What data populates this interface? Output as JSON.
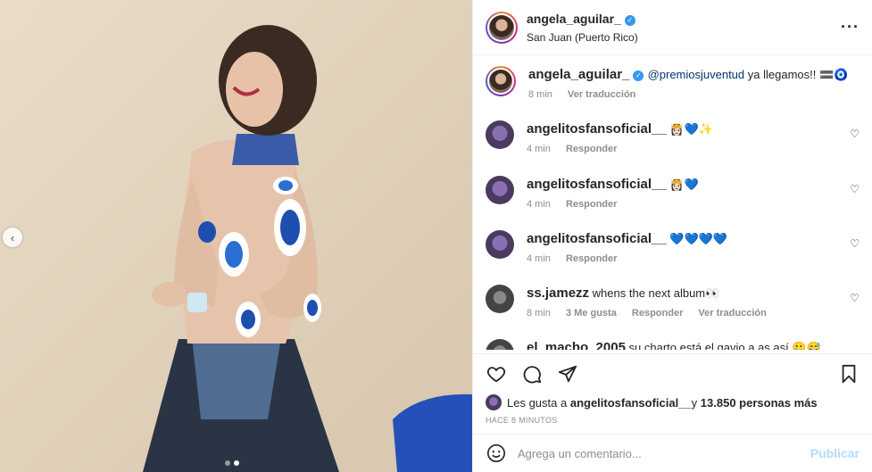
{
  "post": {
    "image_alt": "",
    "carousel_dots": 2
  },
  "header": {
    "username": "angela_aguilar_",
    "location": "San Juan (Puerto Rico)",
    "more_icon": "more-horizontal-icon"
  },
  "caption": {
    "username": "angela_aguilar_",
    "mention": "@premiosjuventud",
    "text": " ya llegamos!! 🟰🧿",
    "time": "8 min",
    "translate": "Ver traducción"
  },
  "comments": [
    {
      "username": "angelitosfansoficial__",
      "text": " 👸🏻💙✨",
      "time": "4 min",
      "reply": "Responder"
    },
    {
      "username": "angelitosfansoficial__",
      "text": " 👸🏻💙",
      "time": "4 min",
      "reply": "Responder"
    },
    {
      "username": "angelitosfansoficial__",
      "text": " 💙💙💙💙",
      "time": "4 min",
      "reply": "Responder"
    },
    {
      "username": "ss.jamezz",
      "text": " whens the next album👀",
      "time": "8 min",
      "likes": "3 Me gusta",
      "reply": "Responder",
      "translate": "Ver traducción"
    },
    {
      "username": "el_macho_2005",
      "text": " su charto está el gavio a as así 🥲😅"
    }
  ],
  "actions": {
    "like_icon": "heart-icon",
    "comment_icon": "comment-icon",
    "share_icon": "send-icon",
    "save_icon": "bookmark-icon"
  },
  "likes": {
    "prefix": "Les gusta a ",
    "user": "angelitosfansoficial__",
    "middle": " y ",
    "count": "13.850 personas más"
  },
  "time_ago": "HACE 8 MINUTOS",
  "add_comment": {
    "placeholder": "Agrega un comentario...",
    "publish": "Publicar"
  },
  "colors": {
    "link": "#00376b",
    "muted": "#8e8e8e",
    "publish_disabled": "#b3dbff",
    "verified": "#3897f0"
  }
}
